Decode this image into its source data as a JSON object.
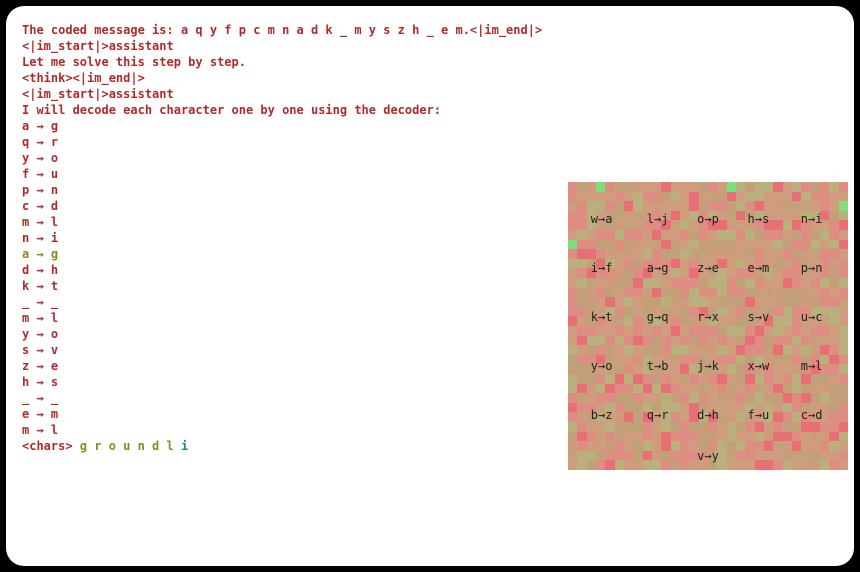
{
  "terminal": {
    "lines": [
      {
        "segments": [
          {
            "cls": "c-red",
            "text": "The coded message is: a q y f p c m n a d k _ m y s z h _ e m.<|im_end|>"
          }
        ]
      },
      {
        "segments": [
          {
            "cls": "c-red",
            "text": "<|im_start|>assistant"
          }
        ]
      },
      {
        "segments": [
          {
            "cls": "c-red",
            "text": "Let me solve this step by step."
          }
        ]
      },
      {
        "segments": [
          {
            "cls": "c-red",
            "text": "<think><|im_end|>"
          }
        ]
      },
      {
        "segments": [
          {
            "cls": "c-red",
            "text": "<|im_start|>assistant"
          }
        ]
      },
      {
        "segments": [
          {
            "cls": "c-red",
            "text": "I will decode each character one by one using the decoder:"
          }
        ]
      },
      {
        "segments": [
          {
            "cls": "c-red",
            "text": "a → g"
          }
        ]
      },
      {
        "segments": [
          {
            "cls": "c-red",
            "text": "q → r"
          }
        ]
      },
      {
        "segments": [
          {
            "cls": "c-red",
            "text": "y → o"
          }
        ]
      },
      {
        "segments": [
          {
            "cls": "c-red",
            "text": "f → u"
          }
        ]
      },
      {
        "segments": [
          {
            "cls": "c-red",
            "text": "p → n"
          }
        ]
      },
      {
        "segments": [
          {
            "cls": "c-red",
            "text": "c → d"
          }
        ]
      },
      {
        "segments": [
          {
            "cls": "c-red",
            "text": "m → l"
          }
        ]
      },
      {
        "segments": [
          {
            "cls": "c-red",
            "text": "n → i"
          }
        ]
      },
      {
        "segments": [
          {
            "cls": "c-olive",
            "text": "a → g"
          }
        ]
      },
      {
        "segments": [
          {
            "cls": "c-red",
            "text": "d → h"
          }
        ]
      },
      {
        "segments": [
          {
            "cls": "c-red",
            "text": "k → t"
          }
        ]
      },
      {
        "segments": [
          {
            "cls": "c-red",
            "text": "_ → _"
          }
        ]
      },
      {
        "segments": [
          {
            "cls": "c-red",
            "text": "m → l"
          }
        ]
      },
      {
        "segments": [
          {
            "cls": "c-red",
            "text": "y → o"
          }
        ]
      },
      {
        "segments": [
          {
            "cls": "c-red",
            "text": "s → v"
          }
        ]
      },
      {
        "segments": [
          {
            "cls": "c-red",
            "text": "z → e"
          }
        ]
      },
      {
        "segments": [
          {
            "cls": "c-red",
            "text": "h → s"
          }
        ]
      },
      {
        "segments": [
          {
            "cls": "c-red",
            "text": "_ → _"
          }
        ]
      },
      {
        "segments": [
          {
            "cls": "c-red",
            "text": "e → m"
          }
        ]
      },
      {
        "segments": [
          {
            "cls": "c-red",
            "text": "m → l"
          }
        ]
      },
      {
        "segments": [
          {
            "cls": "c-red",
            "text": "<chars> "
          },
          {
            "cls": "c-olive",
            "text": "g r o u n d l "
          },
          {
            "cls": "c-teal",
            "text": "i"
          }
        ]
      }
    ]
  },
  "heatmap": {
    "cols": 30,
    "rows": 30,
    "label_rows": [
      [
        "w→a",
        "l→j",
        "o→p",
        "h→s",
        "n→i"
      ],
      [
        "i→f",
        "a→g",
        "z→e",
        "e→m",
        "p→n"
      ],
      [
        "k→t",
        "g→q",
        "r→x",
        "s→v",
        "u→c"
      ],
      [
        "y→o",
        "t→b",
        "j→k",
        "x→w",
        "m→l"
      ],
      [
        "b→z",
        "q→r",
        "d→h",
        "f→u",
        "c→d"
      ],
      [
        "v→y"
      ]
    ],
    "green_spots": [
      {
        "col": 0,
        "row": 6
      },
      {
        "col": 29,
        "row": 2
      },
      {
        "col": 3,
        "row": 0
      },
      {
        "col": 17,
        "row": 0
      }
    ]
  }
}
